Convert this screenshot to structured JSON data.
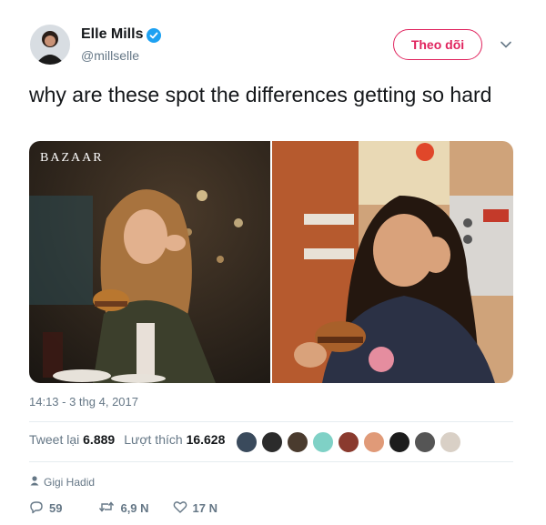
{
  "author": {
    "name": "Elle Mills",
    "handle": "@millselle",
    "verified": true
  },
  "follow_button": {
    "label": "Theo dõi",
    "color": "#e0245e"
  },
  "tweet": {
    "text": "why are these spot the differences getting so hard",
    "timestamp": "14:13 - 3 thg 4, 2017",
    "photo_left_watermark": "BAZAAR"
  },
  "stats": {
    "retweets_label": "Tweet lại",
    "retweets": "6.889",
    "likes_label": "Lượt thích",
    "likes": "16.628"
  },
  "likers": [
    {
      "color": "#3a4a5c"
    },
    {
      "color": "#2b2b2b"
    },
    {
      "color": "#4a3b2e"
    },
    {
      "color": "#7fd1c6"
    },
    {
      "color": "#8a3a2e"
    },
    {
      "color": "#e09a78"
    },
    {
      "color": "#1c1c1c"
    },
    {
      "color": "#555555"
    },
    {
      "color": "#d9d0c6"
    }
  ],
  "reply_context": {
    "icon": "person-icon",
    "name": "Gigi Hadid"
  },
  "actions": {
    "reply_count": "59",
    "retweet_count": "6,9 N",
    "like_count": "17 N"
  },
  "colors": {
    "text_primary": "#14171a",
    "text_secondary": "#657786",
    "verified_blue": "#1da1f2",
    "divider": "#e6ecf0"
  }
}
